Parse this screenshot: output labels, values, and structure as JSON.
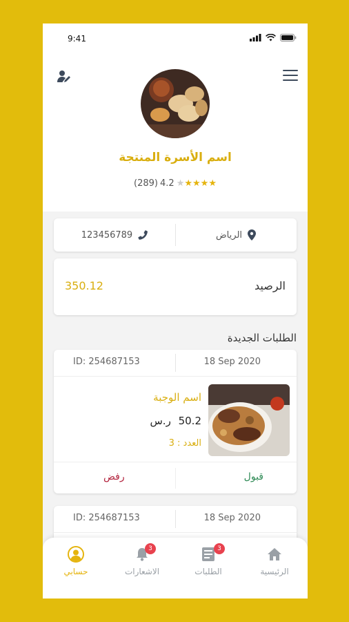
{
  "status_bar": {
    "time": "9:41"
  },
  "profile": {
    "family_name": "اسم الأسرة المنتجة",
    "rating_value": "4.2",
    "rating_count": "(289)",
    "stars_filled": 4,
    "stars_total": 5
  },
  "info": {
    "city": "الرياض",
    "phone": "123456789"
  },
  "balance": {
    "label": "الرصيد",
    "amount": "350.12"
  },
  "orders_section": {
    "title": "الطلبات الجديدة"
  },
  "orders": [
    {
      "date": "18 Sep 2020",
      "id_label": "ID: 254687153",
      "meal_name": "اسم الوجبة",
      "price": "50.2",
      "currency": "ر.س",
      "quantity": "العدد : 3",
      "accept_label": "قبول",
      "reject_label": "رفض"
    },
    {
      "date": "18 Sep 2020",
      "id_label": "ID: 254687153"
    }
  ],
  "nav": {
    "home": "الرئيسية",
    "orders": "الطلبات",
    "orders_badge": "3",
    "notifications": "الاشعارات",
    "notifications_badge": "3",
    "account": "حسابي"
  },
  "colors": {
    "accent": "#E2BC0C",
    "accept": "#2E8A55",
    "reject": "#B3243E",
    "badge": "#E8424E"
  }
}
